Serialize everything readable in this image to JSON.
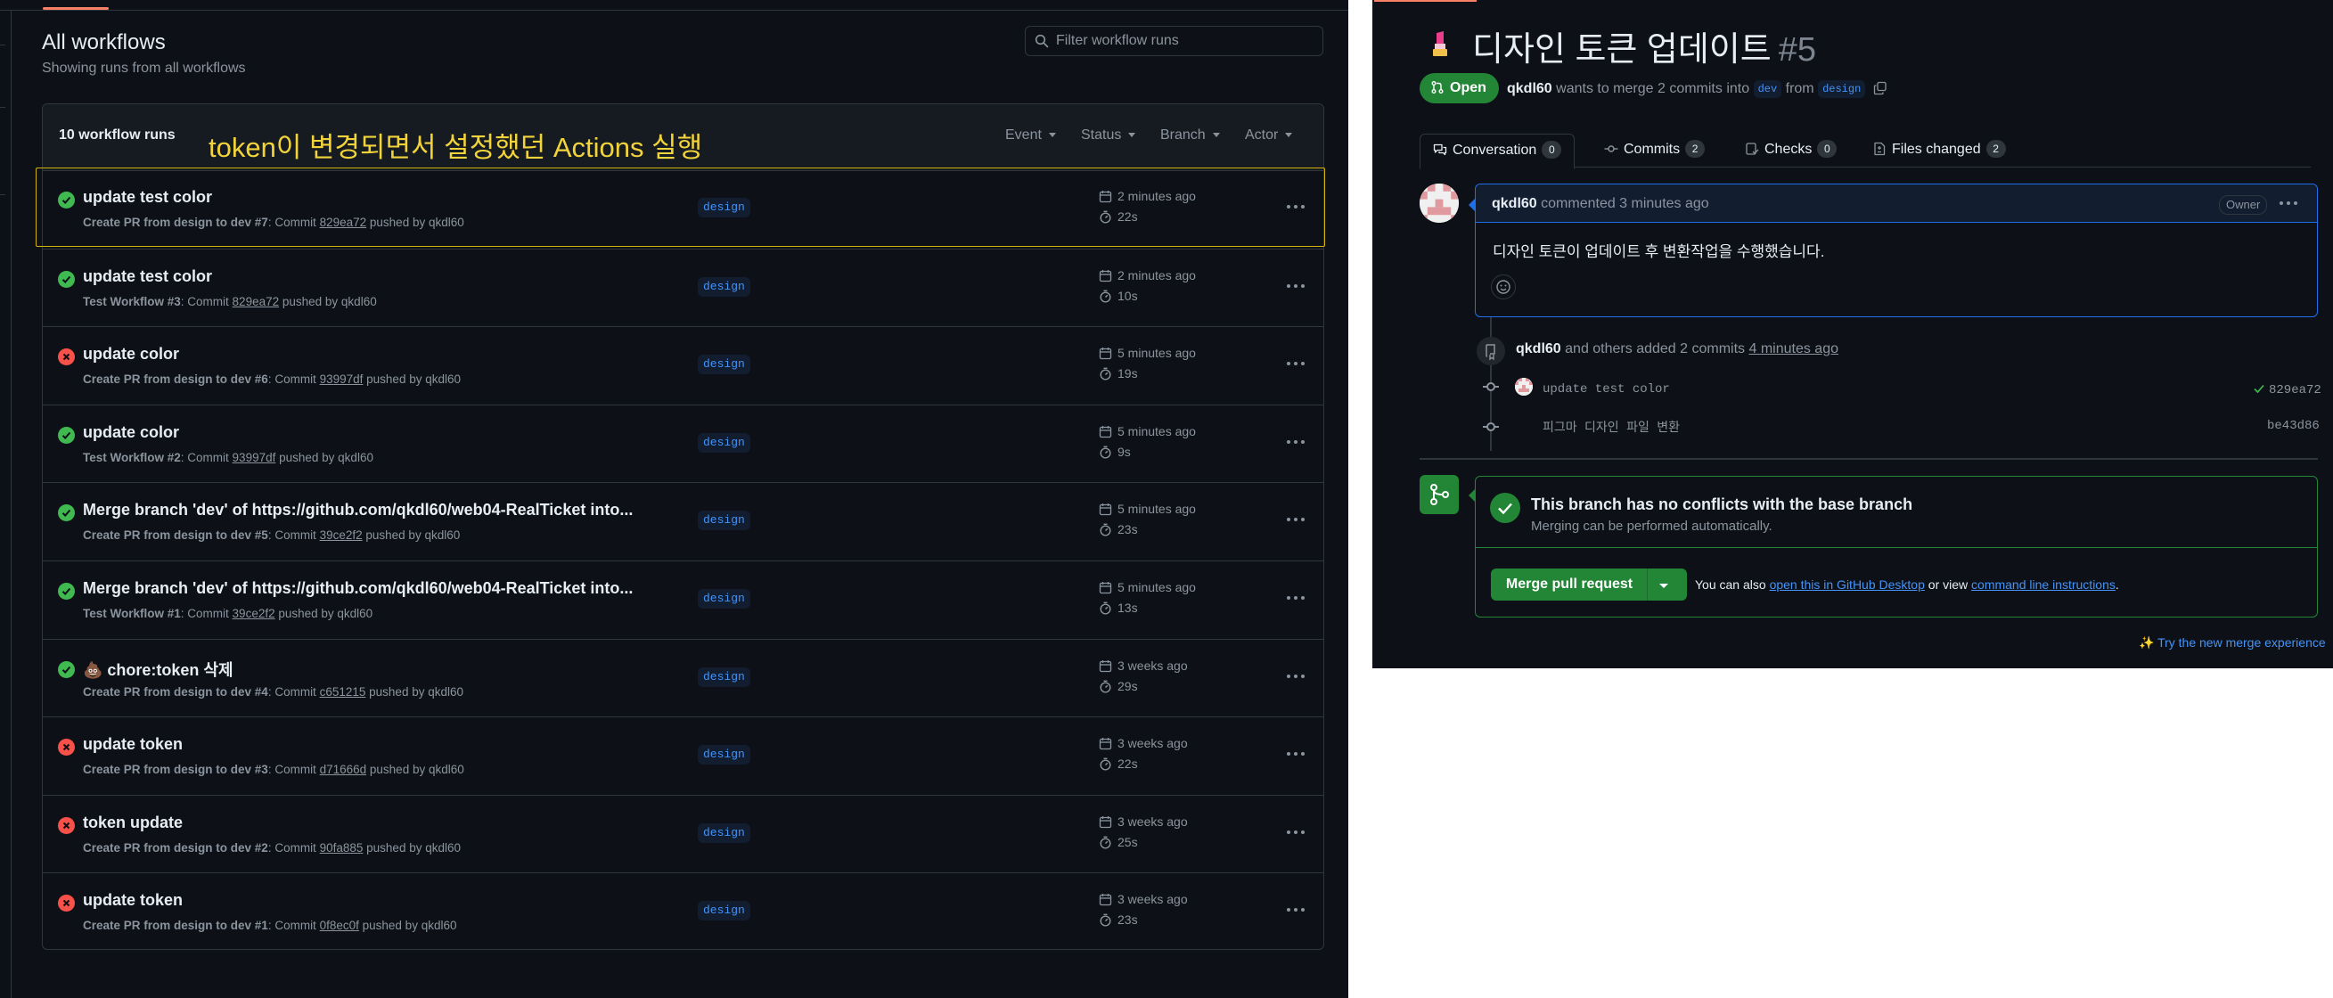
{
  "workflows": {
    "title": "All workflows",
    "subtitle": "Showing runs from all workflows",
    "filter_placeholder": "Filter workflow runs",
    "runs_count": "10 workflow runs",
    "annotation": "token이 변경되면서 설정했던 Actions 실행",
    "filters": [
      "Event",
      "Status",
      "Branch",
      "Actor"
    ],
    "runs": [
      {
        "status": "success",
        "title": "update test color",
        "workflow": "Create PR from design to dev #7",
        "commit_label": ": Commit",
        "commit": "829ea72",
        "pushed_by": "pushed by qkdl60",
        "branch": "design",
        "when": "2 minutes ago",
        "duration": "22s"
      },
      {
        "status": "success",
        "title": "update test color",
        "workflow": "Test Workflow #3",
        "commit_label": ": Commit",
        "commit": "829ea72",
        "pushed_by": "pushed by qkdl60",
        "branch": "design",
        "when": "2 minutes ago",
        "duration": "10s"
      },
      {
        "status": "failure",
        "title": "update color",
        "workflow": "Create PR from design to dev #6",
        "commit_label": ": Commit",
        "commit": "93997df",
        "pushed_by": "pushed by qkdl60",
        "branch": "design",
        "when": "5 minutes ago",
        "duration": "19s"
      },
      {
        "status": "success",
        "title": "update color",
        "workflow": "Test Workflow #2",
        "commit_label": ": Commit",
        "commit": "93997df",
        "pushed_by": "pushed by qkdl60",
        "branch": "design",
        "when": "5 minutes ago",
        "duration": "9s"
      },
      {
        "status": "success",
        "title": "Merge branch 'dev' of https://github.com/qkdl60/web04-RealTicket into...",
        "workflow": "Create PR from design to dev #5",
        "commit_label": ": Commit",
        "commit": "39ce2f2",
        "pushed_by": "pushed by qkdl60",
        "branch": "design",
        "when": "5 minutes ago",
        "duration": "23s"
      },
      {
        "status": "success",
        "title": "Merge branch 'dev' of https://github.com/qkdl60/web04-RealTicket into...",
        "workflow": "Test Workflow #1",
        "commit_label": ": Commit",
        "commit": "39ce2f2",
        "pushed_by": "pushed by qkdl60",
        "branch": "design",
        "when": "5 minutes ago",
        "duration": "13s"
      },
      {
        "status": "success",
        "title": "💩 chore:token 삭제",
        "workflow": "Create PR from design to dev #4",
        "commit_label": ": Commit",
        "commit": "c651215",
        "pushed_by": "pushed by qkdl60",
        "branch": "design",
        "when": "3 weeks ago",
        "duration": "29s"
      },
      {
        "status": "failure",
        "title": "update token",
        "workflow": "Create PR from design to dev #3",
        "commit_label": ": Commit",
        "commit": "d71666d",
        "pushed_by": "pushed by qkdl60",
        "branch": "design",
        "when": "3 weeks ago",
        "duration": "22s"
      },
      {
        "status": "failure",
        "title": "token update",
        "workflow": "Create PR from design to dev #2",
        "commit_label": ": Commit",
        "commit": "90fa885",
        "pushed_by": "pushed by qkdl60",
        "branch": "design",
        "when": "3 weeks ago",
        "duration": "25s"
      },
      {
        "status": "failure",
        "title": "update token",
        "workflow": "Create PR from design to dev #1",
        "commit_label": ": Commit",
        "commit": "0f8ec0f",
        "pushed_by": "pushed by qkdl60",
        "branch": "design",
        "when": "3 weeks ago",
        "duration": "23s"
      }
    ]
  },
  "pr": {
    "title": "디자인 토큰 업데이트",
    "number": "#5",
    "state": "Open",
    "author": "qkdl60",
    "meta_text": "wants to merge 2 commits into",
    "base_branch": "dev",
    "from_text": "from",
    "head_branch": "design",
    "tabs": [
      {
        "label": "Conversation",
        "count": "0"
      },
      {
        "label": "Commits",
        "count": "2"
      },
      {
        "label": "Checks",
        "count": "0"
      },
      {
        "label": "Files changed",
        "count": "2"
      }
    ],
    "comment": {
      "author": "qkdl60",
      "action": "commented 3 minutes ago",
      "role": "Owner",
      "body": "디자인 토큰이 업데이트 후 변환작업을 수행했습니다."
    },
    "event": {
      "author": "qkdl60",
      "text": "and others added 2 commits",
      "time": "4 minutes ago"
    },
    "commits": [
      {
        "message": "update test color",
        "sha": "829ea72",
        "verified": true
      },
      {
        "message": "피그마 디자인 파일 변환",
        "sha": "be43d86",
        "verified": false
      }
    ],
    "merge": {
      "title": "This branch has no conflicts with the base branch",
      "subtitle": "Merging can be performed automatically.",
      "button": "Merge pull request",
      "also_prefix": "You can also",
      "desktop_link": "open this in GitHub Desktop",
      "or_view": "or view",
      "cli_link": "command line instructions",
      "period": "."
    },
    "try_new": "✨ Try the new merge experience"
  },
  "colors": {
    "bg": "#0d1117",
    "success": "#3fb950",
    "failure": "#f85149",
    "link": "#4493f8",
    "merge_green": "#238636",
    "annotation": "#f2d33a"
  }
}
